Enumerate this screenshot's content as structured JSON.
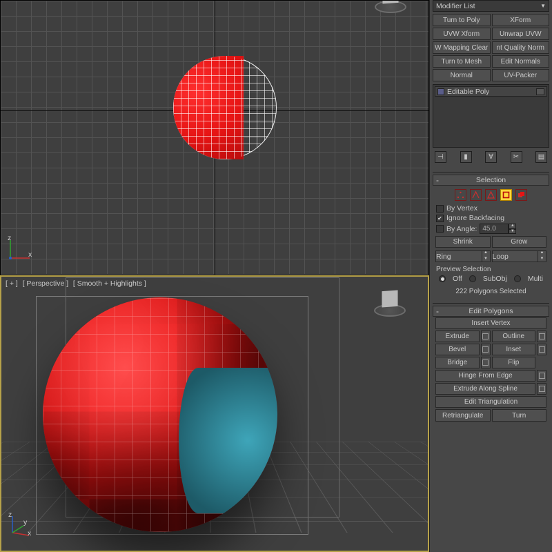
{
  "viewport_top": {
    "labels": [
      "",
      "",
      ""
    ]
  },
  "viewport_bottom": {
    "labels": [
      "[ + ]",
      "[ Perspective ]",
      "[ Smooth + Highlights ]"
    ]
  },
  "modifier_list_label": "Modifier List",
  "modifier_buttons": [
    "Turn to Poly",
    "XForm",
    "UVW Xform",
    "Unwrap UVW",
    "W Mapping Clear",
    "nt Quality Norm",
    "Turn to Mesh",
    "Edit Normals",
    "Normal",
    "UV-Packer"
  ],
  "stack_item": "Editable Poly",
  "selection": {
    "title": "Selection",
    "by_vertex": "By Vertex",
    "ignore_backfacing": "Ignore Backfacing",
    "by_angle": "By Angle:",
    "angle_value": "45.0",
    "shrink": "Shrink",
    "grow": "Grow",
    "ring": "Ring",
    "loop": "Loop",
    "preview": "Preview Selection",
    "off": "Off",
    "subobj": "SubObj",
    "multi": "Multi",
    "status": "222 Polygons Selected"
  },
  "edit_polygons": {
    "title": "Edit Polygons",
    "insert_vertex": "Insert Vertex",
    "extrude": "Extrude",
    "outline": "Outline",
    "bevel": "Bevel",
    "inset": "Inset",
    "bridge": "Bridge",
    "flip": "Flip",
    "hinge": "Hinge From Edge",
    "extrude_spline": "Extrude Along Spline",
    "edit_tri": "Edit Triangulation",
    "retriangulate": "Retriangulate",
    "turn": "Turn"
  }
}
